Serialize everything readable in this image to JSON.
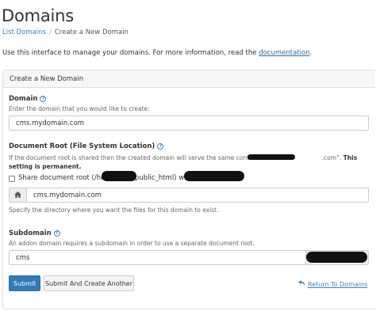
{
  "page": {
    "title": "Domains",
    "breadcrumb": {
      "parent": "List Domains",
      "current": "Create a New Domain"
    },
    "intro": {
      "text": "Use this interface to manage your domains. For more information, read the ",
      "link": "documentation",
      "suffix": "."
    }
  },
  "panel": {
    "heading": "Create a New Domain",
    "domain": {
      "label": "Domain",
      "help": "?",
      "description": "Enter the domain that you would like to create:",
      "value": "cms.mydomain.com"
    },
    "document_root": {
      "label": "Document Root (File System Location)",
      "help": "?",
      "description_prefix": "If the document root is shared then the created domain will serve the same content as “",
      "description_suffix": ".com”.",
      "description_bold": "This setting is permanent.",
      "share_checked": false,
      "share_label_prefix": "Share document root (/home",
      "share_label_mid": "public_html) with",
      "home_icon": "home-icon",
      "value": "cms.mydomain.com",
      "hint": "Specify the directory where you want the files for this domain to exist."
    },
    "subdomain": {
      "label": "Subdomain",
      "help": "?",
      "description": "An addon domain requires a subdomain in order to use a separate document root.",
      "value": "cms"
    },
    "actions": {
      "submit": "Submit",
      "submit_another": "Submit And Create Another",
      "return_icon": "return-arrow-icon",
      "return": "Return To Domains"
    }
  },
  "colors": {
    "accent": "#337ab7",
    "link": "#3b82c4"
  }
}
